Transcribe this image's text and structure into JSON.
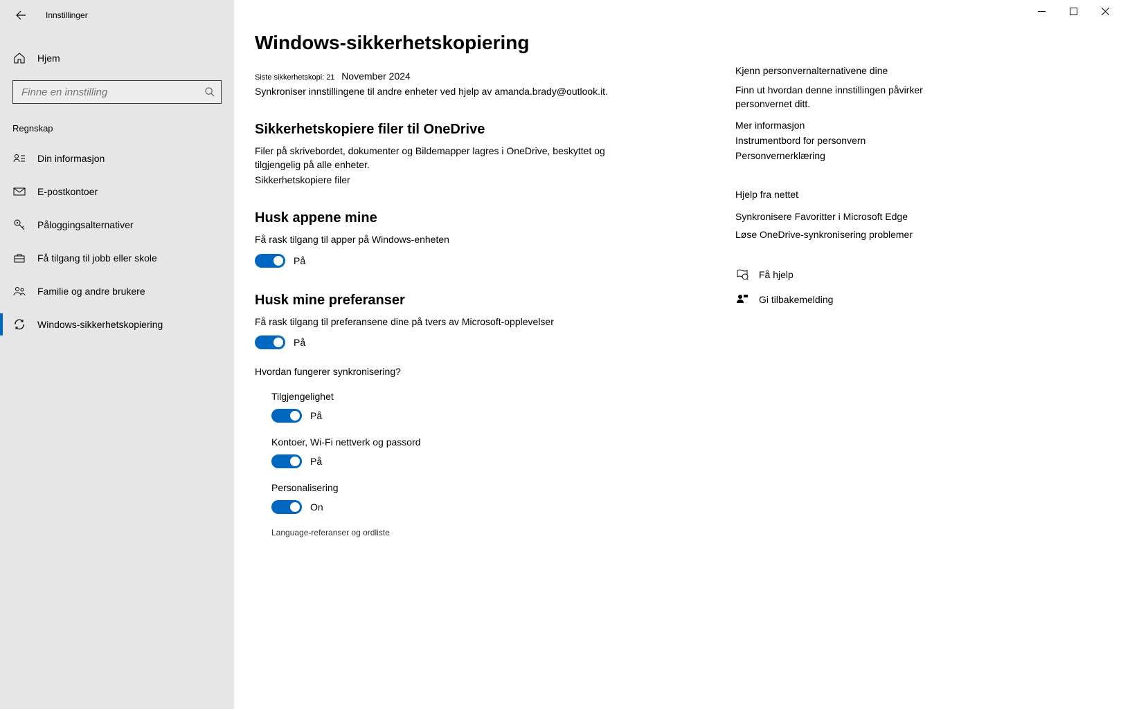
{
  "window": {
    "app_title": "Innstillinger"
  },
  "sidebar": {
    "home": "Hjem",
    "search_placeholder": "Finne en innstilling",
    "section": "Regnskap",
    "items": [
      {
        "label": "Din informasjon"
      },
      {
        "label": "E-postkontoer"
      },
      {
        "label": "Påloggingsalternativer"
      },
      {
        "label": "Få tilgang til jobb eller skole"
      },
      {
        "label": "Familie og andre brukere"
      },
      {
        "label": "Windows-sikkerhetskopiering"
      }
    ]
  },
  "page": {
    "title": "Windows-sikkerhetskopiering",
    "last_backup_label": "Siste sikkerhetskopi: 21",
    "last_backup_date": "November 2024",
    "sync_info": "Synkroniser innstillingene til andre enheter ved hjelp av amanda.brady@outlook.it.",
    "onedrive_heading": "Sikkerhetskopiere filer til OneDrive",
    "onedrive_desc": "Filer på skrivebordet, dokumenter og Bildemapper lagres i OneDrive, beskyttet og tilgjengelig på alle enheter.",
    "onedrive_link": "Sikkerhetskopiere filer",
    "apps_heading": "Husk appene mine",
    "apps_desc": "Få rask tilgang til apper på Windows-enheten",
    "apps_toggle": "På",
    "prefs_heading": "Husk mine preferanser",
    "prefs_desc": "Få rask tilgang til preferansene dine på tvers av Microsoft-opplevelser",
    "prefs_toggle": "På",
    "how_sync": "Hvordan fungerer synkronisering?",
    "sub": [
      {
        "label": "Tilgjengelighet",
        "state": "På"
      },
      {
        "label": "Kontoer, Wi-Fi nettverk og passord",
        "state": "På"
      },
      {
        "label": "Personalisering",
        "state": "On"
      }
    ],
    "sub_cut": "Language-referanser og ordliste"
  },
  "side": {
    "privacy_heading": "Kjenn personvernalternativene dine",
    "privacy_text": "Finn ut hvordan denne innstillingen påvirker personvernet ditt.",
    "privacy_links": [
      "Mer informasjon",
      "Instrumentbord for personvern",
      "Personvernerklæring"
    ],
    "web_heading": "Hjelp fra nettet",
    "web_links": [
      "Synkronisere Favoritter i Microsoft Edge",
      "Løse OneDrive-synkronisering problemer"
    ],
    "help": "Få hjelp",
    "feedback": "Gi tilbakemelding"
  }
}
